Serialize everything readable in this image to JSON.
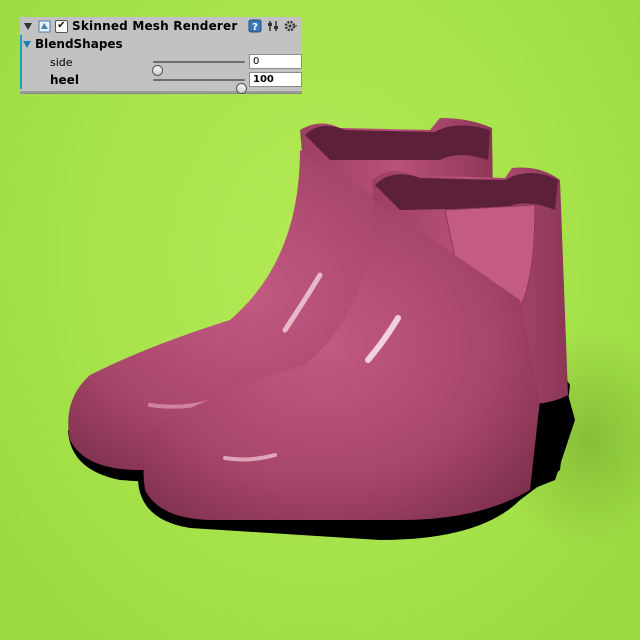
{
  "component": {
    "title": "Skinned Mesh Renderer",
    "enabled_mark": "✔",
    "icons": [
      "component-icon",
      "help-icon",
      "preset-icon",
      "settings-gear-icon"
    ]
  },
  "blendshapes": {
    "title": "BlendShapes",
    "items": [
      {
        "label": "side",
        "value": "0",
        "fraction": 0.0,
        "bold": false
      },
      {
        "label": "heel",
        "value": "100",
        "fraction": 1.0,
        "bold": true
      }
    ]
  },
  "colors": {
    "background": "#a6e24a",
    "boot": "#b04a70",
    "sole": "#000000",
    "panel": "#c2c2c2",
    "accent": "#1a7fb8"
  }
}
